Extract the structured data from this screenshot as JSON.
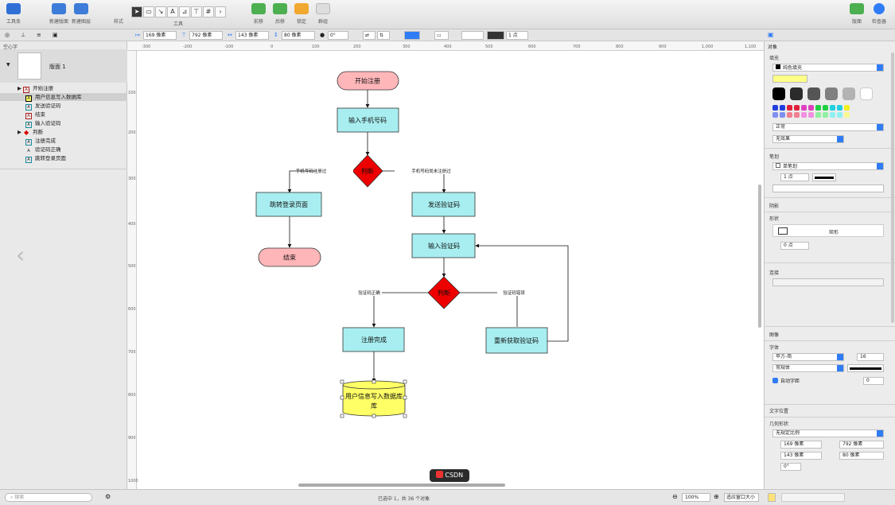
{
  "toolbar": {
    "left_buttons": [
      "工具条",
      "新建版面",
      "新建图层",
      "样式"
    ],
    "tools_label": "工具",
    "arrange_buttons": [
      "前移",
      "后移",
      "锁定",
      "群组"
    ],
    "right_buttons": [
      "版面",
      "检查器"
    ]
  },
  "inspector_bar": {
    "x": "169 像素",
    "y": "792 像素",
    "w": "143 像素",
    "h": "80 像素",
    "angle": "0°",
    "stroke": "1 点"
  },
  "left": {
    "section": "空心字",
    "canvas_name": "版面 1",
    "layers": [
      "开始注册",
      "用户信息写入数据库",
      "发送验证码",
      "结束",
      "输入验证码",
      "判断",
      "注册完成",
      "验证码正确",
      "跳转登录页面"
    ],
    "search_placeholder": "搜索"
  },
  "ruler": {
    "top": [
      "-300",
      "-200",
      "-100",
      "0",
      "100",
      "200",
      "300",
      "400",
      "500",
      "600",
      "700",
      "800",
      "900",
      "1,000",
      "1,100"
    ],
    "left": [
      "100",
      "200",
      "300",
      "400",
      "500",
      "600",
      "700",
      "800",
      "900",
      "1000"
    ]
  },
  "diagram": {
    "start": "开始注册",
    "input_phone": "输入手机号码",
    "decision1": "判断",
    "label_registered": "手机号码注册过",
    "label_unregistered": "手机号码尚未注册过",
    "goto_login": "跳转登录页面",
    "end": "结束",
    "send_code": "发送验证码",
    "input_code": "输入验证码",
    "decision2": "判断",
    "label_correct": "验证码正确",
    "label_wrong": "验证码错误",
    "reg_done": "注册完成",
    "re_get_code": "重新获取验证码",
    "db_write": "用户信息写入数据库"
  },
  "right": {
    "tabs_title": "对象",
    "fill_title": "填充",
    "fill_type": "纯色填充",
    "fill_mode": "正常",
    "fill_effect": "无效果",
    "stroke_title": "笔划",
    "stroke_type": "单笔划",
    "stroke_width": "1 点",
    "shadow_title": "阴影",
    "shape_title": "形状",
    "shape_name": "矩形",
    "corner": "0 点",
    "connect_title": "连接",
    "image_title": "图像",
    "font_title": "字体",
    "font_name": "苹方-简",
    "font_size": "16",
    "font_weight": "常规体",
    "auto_fit": "自动字距",
    "text_pos_title": "文字位置",
    "geometry_title": "几何形状",
    "aspect": "无规定比例",
    "gx": "169 像素",
    "gy": "792 像素",
    "gw": "143 像素",
    "gh": "80 像素",
    "gangle": "0°",
    "spacing": "0",
    "palette_colors": [
      "#000000",
      "#2b2b2b",
      "#555555",
      "#808080",
      "#b3b3b3",
      "#ffffff"
    ]
  },
  "status": {
    "selection": "已选中 1，共 36 个对象",
    "zoom": "100%",
    "fit": "适应窗口大小",
    "watermark": "CSDN"
  }
}
